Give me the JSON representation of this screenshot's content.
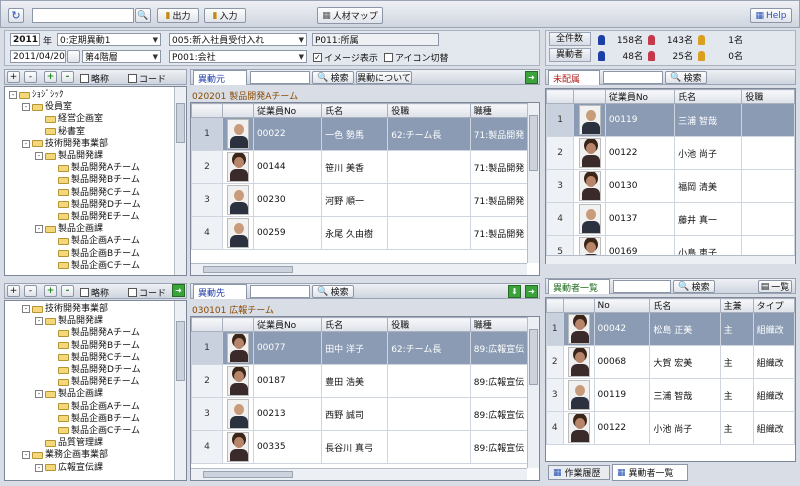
{
  "toolbar": {
    "search_value": "",
    "output_label": "出力",
    "input_label": "入力",
    "talent_map_label": "人材マップ",
    "help_label": "Help"
  },
  "filters": {
    "year": "2011",
    "year_unit": "年",
    "period": "0:定期異動1",
    "plan": "005:新入社員受付入れ",
    "dept_code_label": "P011:所属",
    "date": "2011/04/20",
    "level": "第4階層",
    "company": "P001:会社",
    "image_display_label": "イメージ表示",
    "icon_switch_label": "アイコン切替"
  },
  "stats": {
    "total_label": "全件数",
    "moved_label": "異動者",
    "total_values": [
      "158名",
      "143名",
      "1名"
    ],
    "moved_values": [
      "48名",
      "25名",
      "0名"
    ],
    "colors": [
      "#1f3fa8",
      "#c43a4a",
      "#d9a020"
    ]
  },
  "tree_toolbar": {
    "abbrev_label": "略称",
    "code_label": "コード"
  },
  "tree_top": [
    {
      "label": "ｼｮｼﾞｼｯｸ",
      "depth": 0,
      "toggle": "-"
    },
    {
      "label": "役員室",
      "depth": 1,
      "toggle": "-"
    },
    {
      "label": "経営企画室",
      "depth": 2,
      "toggle": ""
    },
    {
      "label": "秘書室",
      "depth": 2,
      "toggle": ""
    },
    {
      "label": "技術開発事業部",
      "depth": 1,
      "toggle": "-"
    },
    {
      "label": "製品開発課",
      "depth": 2,
      "toggle": "-"
    },
    {
      "label": "製品開発Aチーム",
      "depth": 3,
      "toggle": ""
    },
    {
      "label": "製品開発Bチーム",
      "depth": 3,
      "toggle": ""
    },
    {
      "label": "製品開発Cチーム",
      "depth": 3,
      "toggle": ""
    },
    {
      "label": "製品開発Dチーム",
      "depth": 3,
      "toggle": ""
    },
    {
      "label": "製品開発Eチーム",
      "depth": 3,
      "toggle": ""
    },
    {
      "label": "製品企画課",
      "depth": 2,
      "toggle": "-"
    },
    {
      "label": "製品企画Aチーム",
      "depth": 3,
      "toggle": ""
    },
    {
      "label": "製品企画Bチーム",
      "depth": 3,
      "toggle": ""
    },
    {
      "label": "製品企画Cチーム",
      "depth": 3,
      "toggle": ""
    }
  ],
  "tree_bottom": [
    {
      "label": "技術開発事業部",
      "depth": 1,
      "toggle": "-"
    },
    {
      "label": "製品開発課",
      "depth": 2,
      "toggle": "-"
    },
    {
      "label": "製品開発Aチーム",
      "depth": 3,
      "toggle": ""
    },
    {
      "label": "製品開発Bチーム",
      "depth": 3,
      "toggle": ""
    },
    {
      "label": "製品開発Cチーム",
      "depth": 3,
      "toggle": ""
    },
    {
      "label": "製品開発Dチーム",
      "depth": 3,
      "toggle": ""
    },
    {
      "label": "製品開発Eチーム",
      "depth": 3,
      "toggle": ""
    },
    {
      "label": "製品企画課",
      "depth": 2,
      "toggle": "-"
    },
    {
      "label": "製品企画Aチーム",
      "depth": 3,
      "toggle": ""
    },
    {
      "label": "製品企画Bチーム",
      "depth": 3,
      "toggle": ""
    },
    {
      "label": "製品企画Cチーム",
      "depth": 3,
      "toggle": ""
    },
    {
      "label": "品質管理課",
      "depth": 2,
      "toggle": ""
    },
    {
      "label": "業務企画事業部",
      "depth": 1,
      "toggle": "-"
    },
    {
      "label": "広報宣伝課",
      "depth": 2,
      "toggle": "-"
    }
  ],
  "source": {
    "tab_label": "異動元",
    "search_label": "検索",
    "about_label": "異動について",
    "dept": "020201 製品開発Aチーム",
    "columns": [
      "従業員No",
      "氏名",
      "役職",
      "職種"
    ],
    "rows": [
      {
        "no": "1",
        "emp": "00022",
        "name": "一色 勢馬",
        "role": "62:チーム長",
        "job": "71:製品開発",
        "f": false,
        "mark": ""
      },
      {
        "no": "2",
        "emp": "00144",
        "name": "笹川 美香",
        "role": "",
        "job": "71:製品開発",
        "f": true,
        "mark": ""
      },
      {
        "no": "3",
        "emp": "00230",
        "name": "河野 順一",
        "role": "",
        "job": "71:製品開発",
        "f": false,
        "mark": ""
      },
      {
        "no": "4",
        "emp": "00259",
        "name": "永尾 久由樹",
        "role": "",
        "job": "71:製品開発",
        "f": false,
        "mark": ""
      }
    ]
  },
  "dest": {
    "tab_label": "異動先",
    "search_label": "検索",
    "dept": "030101 広報チーム",
    "columns": [
      "従業員No",
      "氏名",
      "役職",
      "職種"
    ],
    "rows": [
      {
        "no": "1",
        "emp": "00077",
        "name": "田中 洋子",
        "role": "62:チーム長",
        "job": "89:広報宣伝",
        "f": true,
        "mark": ""
      },
      {
        "no": "2",
        "emp": "00187",
        "name": "豊田 浩美",
        "role": "",
        "job": "89:広報宣伝",
        "f": true,
        "mark": ""
      },
      {
        "no": "3",
        "emp": "00213",
        "name": "西野 誠司",
        "role": "",
        "job": "89:広報宣伝",
        "f": false,
        "mark": ""
      },
      {
        "no": "4",
        "emp": "00335",
        "name": "長谷川 真弓",
        "role": "",
        "job": "89:広報宣伝",
        "f": true,
        "mark": "*"
      }
    ]
  },
  "unassigned": {
    "tab_label": "未配属",
    "search_label": "検索",
    "columns": [
      "従業員No",
      "氏名",
      "役職"
    ],
    "rows": [
      {
        "no": "1",
        "emp": "00119",
        "name": "三浦 智哉",
        "f": false
      },
      {
        "no": "2",
        "emp": "00122",
        "name": "小池 尚子",
        "f": true
      },
      {
        "no": "3",
        "emp": "00130",
        "name": "福岡 清美",
        "f": true
      },
      {
        "no": "4",
        "emp": "00137",
        "name": "藤井 真一",
        "f": false
      },
      {
        "no": "5",
        "emp": "00169",
        "name": "小島 恵子",
        "f": true
      }
    ]
  },
  "moved_list": {
    "tab_label": "異動者一覧",
    "search_label": "検索",
    "list_button_label": "一覧",
    "columns": [
      "No",
      "氏名",
      "主兼",
      "タイプ"
    ],
    "rows": [
      {
        "no": "1",
        "emp": "00042",
        "name": "松島 正美",
        "main": "主",
        "type": "組織改",
        "f": true
      },
      {
        "no": "2",
        "emp": "00068",
        "name": "大賀 宏美",
        "main": "主",
        "type": "組織改",
        "f": true
      },
      {
        "no": "3",
        "emp": "00119",
        "name": "三浦 智哉",
        "main": "主",
        "type": "組織改",
        "f": false
      },
      {
        "no": "4",
        "emp": "00122",
        "name": "小池 尚子",
        "main": "主",
        "type": "組織改",
        "f": true
      }
    ]
  },
  "bottom_tabs": [
    "作業履歴",
    "異動者一覧"
  ]
}
